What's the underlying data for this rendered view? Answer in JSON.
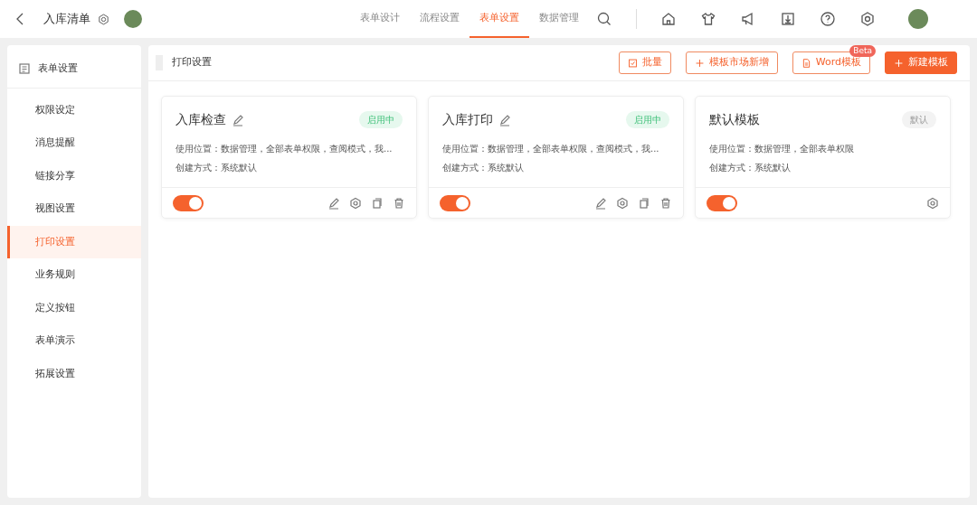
{
  "topbar": {
    "title": "入库清单",
    "nav": [
      {
        "label": "表单设计",
        "selected": false
      },
      {
        "label": "流程设置",
        "selected": false
      },
      {
        "label": "表单设置",
        "selected": true
      },
      {
        "label": "数据管理",
        "selected": false
      }
    ]
  },
  "sidebar": {
    "header": "表单设置",
    "items": [
      {
        "label": "权限设定",
        "selected": false
      },
      {
        "label": "消息提醒",
        "selected": false
      },
      {
        "label": "链接分享",
        "selected": false
      },
      {
        "label": "视图设置",
        "selected": false
      },
      {
        "label": "打印设置",
        "selected": true
      },
      {
        "label": "业务规则",
        "selected": false
      },
      {
        "label": "定义按钮",
        "selected": false
      },
      {
        "label": "表单演示",
        "selected": false
      },
      {
        "label": "拓展设置",
        "selected": false
      }
    ]
  },
  "panel": {
    "title": "打印设置",
    "buttons": [
      {
        "label": "批量",
        "kind": "batch"
      },
      {
        "label": "模板市场新增",
        "kind": "plus"
      },
      {
        "label": "Word模板",
        "kind": "word",
        "badge": "Beta"
      },
      {
        "label": "新建模板",
        "kind": "primary"
      }
    ]
  },
  "cards": [
    {
      "title": "入库检查",
      "editable": true,
      "status": {
        "text": "启用中",
        "kind": "active"
      },
      "usage": "使用位置：数据管理，全部表单权限，查阅模式，我...",
      "created": "创建方式：系统默认",
      "on": true,
      "actions": [
        {
          "kind": "edit"
        },
        {
          "kind": "settings"
        },
        {
          "kind": "copy"
        },
        {
          "kind": "delete"
        }
      ]
    },
    {
      "title": "入库打印",
      "editable": true,
      "status": {
        "text": "启用中",
        "kind": "active"
      },
      "usage": "使用位置：数据管理，全部表单权限，查阅模式，我...",
      "created": "创建方式：系统默认",
      "on": true,
      "actions": [
        {
          "kind": "edit"
        },
        {
          "kind": "settings"
        },
        {
          "kind": "copy"
        },
        {
          "kind": "delete"
        }
      ]
    },
    {
      "title": "默认模板",
      "editable": false,
      "status": {
        "text": "默认",
        "kind": "default"
      },
      "usage": "使用位置：数据管理，全部表单权限",
      "created": "创建方式：系统默认",
      "on": true,
      "actions": [
        {
          "kind": "settings"
        }
      ]
    }
  ]
}
